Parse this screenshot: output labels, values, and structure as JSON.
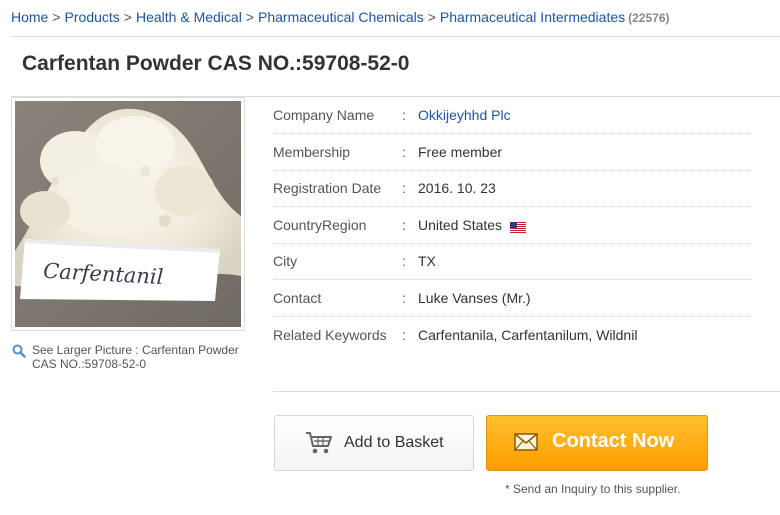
{
  "breadcrumb": {
    "items": [
      "Home",
      "Products",
      "Health & Medical",
      "Pharmaceutical Chemicals",
      "Pharmaceutical Intermediates"
    ],
    "separator": ">",
    "count": "(22576)"
  },
  "product": {
    "title": "Carfentan Powder CAS NO.:59708-52-0",
    "image_label": "Carfentanil",
    "see_larger": "See Larger Picture : Carfentan Powder CAS NO.:59708-52-0"
  },
  "info": {
    "colon": ":",
    "company": {
      "label": "Company Name",
      "value": "Okkijeyhhd Plc"
    },
    "membership": {
      "label": "Membership",
      "value": "Free member"
    },
    "registration": {
      "label": "Registration Date",
      "value": "2016. 10. 23"
    },
    "country": {
      "label": "CountryRegion",
      "value": "United States"
    },
    "city": {
      "label": "City",
      "value": "TX"
    },
    "contact": {
      "label": "Contact",
      "value": "Luke Vanses (Mr.)"
    },
    "keywords": {
      "label": "Related Keywords",
      "value": "Carfentanila, Carfentanilum, Wildnil"
    }
  },
  "actions": {
    "add_to_basket": "Add to Basket",
    "contact_now": "Contact Now",
    "inquiry_note": "* Send an Inquiry to this supplier."
  },
  "colors": {
    "link": "#1a55a8",
    "contact_button": "#ffa500"
  }
}
